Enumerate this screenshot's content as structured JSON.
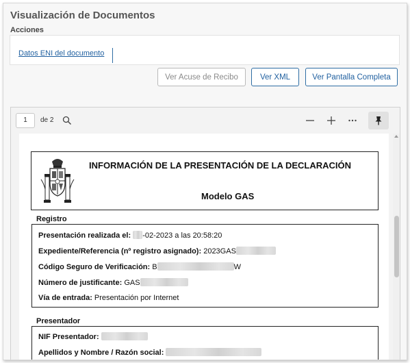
{
  "header": {
    "title": "Visualización de Documentos",
    "actions_label": "Acciones"
  },
  "actions": {
    "eni_link": "Datos ENI del documento"
  },
  "buttons": {
    "acuse": "Ver Acuse de Recibo",
    "xml": "Ver XML",
    "full": "Ver Pantalla Completa"
  },
  "viewer": {
    "page_number": "1",
    "page_of": "de 2",
    "icons": [
      "search-icon",
      "minus-icon",
      "plus-icon",
      "more-icon",
      "pin-icon"
    ]
  },
  "document": {
    "title": "INFORMACIÓN DE LA PRESENTACIÓN DE LA DECLARACIÓN",
    "model": "Modelo GAS",
    "registro": {
      "label": "Registro",
      "rows": [
        {
          "label": "Presentación realizada el:",
          "value": "-02-2023 a las 20:58:20"
        },
        {
          "label": "Expediente/Referencia (nº registro asignado):",
          "value": "2023GAS"
        },
        {
          "label": "Código Seguro de Verificación:",
          "value_start": "B",
          "value_end": "W"
        },
        {
          "label": "Número de justificante:",
          "value": "GAS"
        },
        {
          "label": "Vía de entrada:",
          "value": "Presentación por Internet"
        }
      ]
    },
    "presentador": {
      "label": "Presentador",
      "rows": [
        {
          "label": "NIF Presentador:"
        },
        {
          "label": "Apellidos y Nombre / Razón social:"
        }
      ]
    }
  }
}
